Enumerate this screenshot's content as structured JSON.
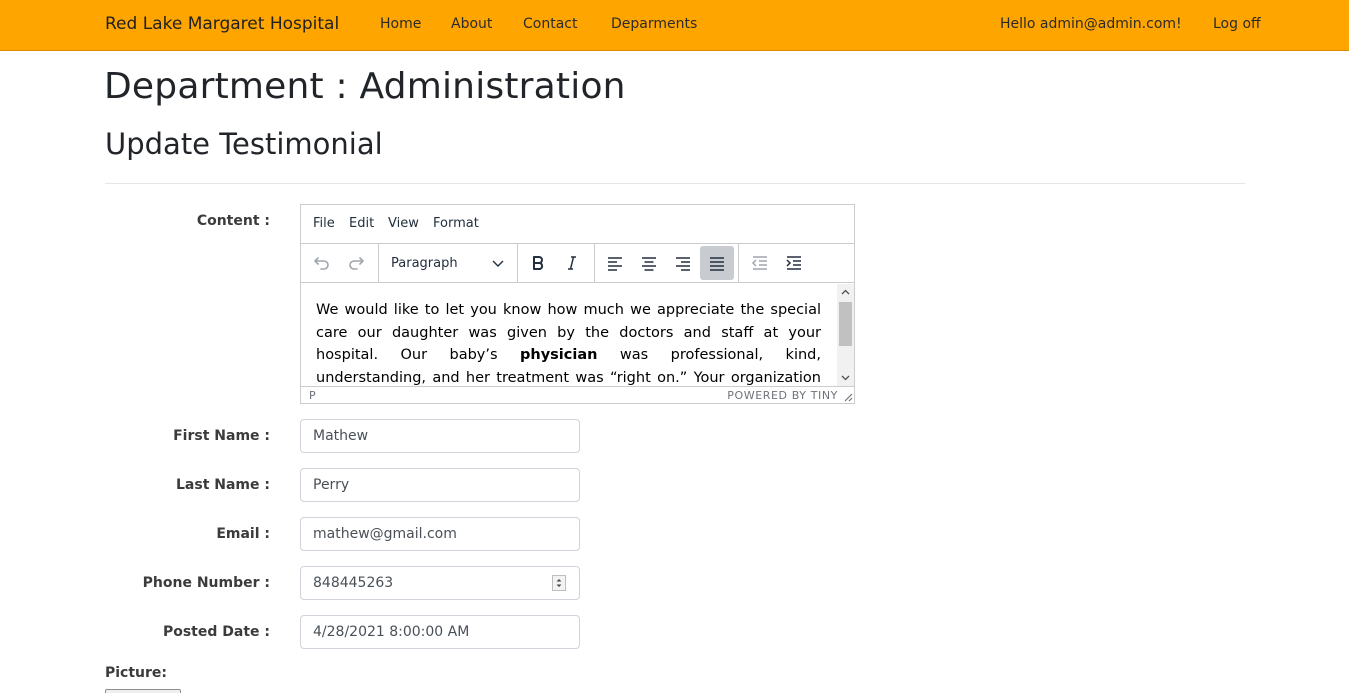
{
  "navbar": {
    "brand": "Red Lake Margaret Hospital",
    "links": [
      "Home",
      "About",
      "Contact",
      "Deparments"
    ],
    "greeting": "Hello admin@admin.com!",
    "logoff": "Log off",
    "background": "#ffa500"
  },
  "page": {
    "title": "Department : Administration",
    "subtitle": "Update Testimonial"
  },
  "form": {
    "content_label": "Content :",
    "editor": {
      "menus": [
        "File",
        "Edit",
        "View",
        "Format"
      ],
      "block_format": "Paragraph",
      "content_before_bold": "We would like to let you know how much we appreciate the special care our daughter was given by the doctors and staff at your hospital. Our baby’s ",
      "content_bold": "physician",
      "content_after_bold": " was professional, kind, understanding, and her treatment was “right on.” Your organization should be proud to have",
      "status_path": "P",
      "status_brand": "POWERED BY TINY",
      "active_button": "align-justify"
    },
    "first_name_label": "First Name :",
    "first_name": "Mathew",
    "last_name_label": "Last Name :",
    "last_name": "Perry",
    "email_label": "Email :",
    "email": "mathew@gmail.com",
    "phone_label": "Phone Number :",
    "phone": "848445263",
    "posted_date_label": "Posted Date :",
    "posted_date": "4/28/2021 8:00:00 AM",
    "picture_label": "Picture:"
  }
}
